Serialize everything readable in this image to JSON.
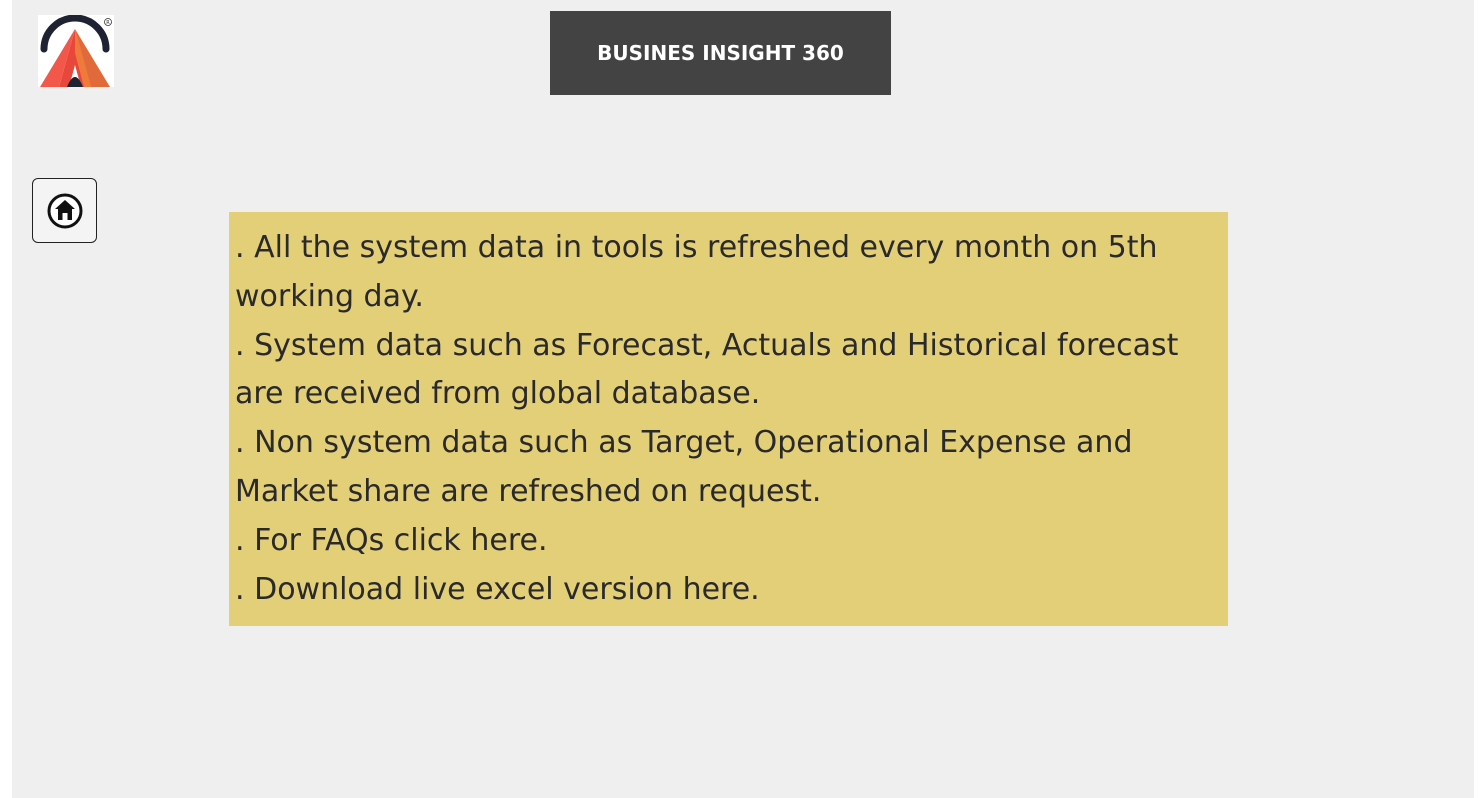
{
  "header": {
    "title": "BUSINES INSIGHT 360",
    "logo_icon": "brand-logo-a-icon",
    "colors": {
      "title_bg": "#434343",
      "title_text": "#ffffff",
      "logo_red": "#e8473b",
      "logo_orange": "#f07a3a",
      "logo_navy": "#1e2233"
    }
  },
  "nav": {
    "home_icon": "home-icon"
  },
  "info": {
    "background": "#e4cf79",
    "lines": [
      {
        "bullet": ".",
        "text": "All the system data in tools is refreshed every month on 5th working day."
      },
      {
        "bullet": ".",
        "text": " System data such as Forecast, Actuals and Historical forecast are received from global database."
      },
      {
        "bullet": ".",
        "text": " Non system data such as Target, Operational Expense and Market share are refreshed on request."
      },
      {
        "bullet": ".",
        "text": " For FAQs click ",
        "link": "here",
        "suffix": "."
      },
      {
        "bullet": ".",
        "text": "Download live excel version ",
        "link": "here",
        "suffix": "."
      }
    ]
  }
}
